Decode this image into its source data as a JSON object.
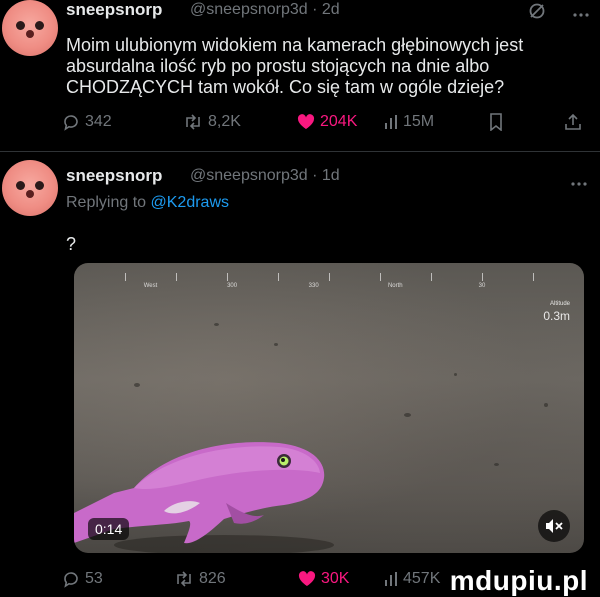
{
  "tweet1": {
    "author": "sneepsnorp",
    "meta": "@sneepsnorp3d · 2d",
    "text_lines": [
      "Moim ulubionym widokiem na kamerach głębinowych jest",
      "absurdalna ilość ryb po prostu stojących na dnie albo",
      "CHODZĄCYCH tam wokół. Co się tam w ogóle dzieje?"
    ],
    "replies": "342",
    "reposts": "8,2K",
    "likes": "204K",
    "views": "15M"
  },
  "tweet2": {
    "author": "sneepsnorp",
    "meta": "@sneepsnorp3d · 1d",
    "replying_label": "Replying to",
    "replying_handle": "@K2draws",
    "text": "?",
    "video": {
      "heading_labels": [
        "West",
        "300",
        "330",
        "North",
        "30"
      ],
      "altitude_label": "Altitude",
      "altitude_value": "0.3m",
      "time": "0:14"
    },
    "replies": "53",
    "reposts": "826",
    "likes": "30K",
    "views": "457K"
  },
  "icons": {
    "reply": "reply-icon",
    "repost": "repost-icon",
    "like": "heart-icon",
    "views": "views-icon",
    "bookmark": "bookmark-icon",
    "share": "share-icon",
    "more": "more-icon",
    "grok": "grok-icon",
    "mute": "volume-muted-icon"
  },
  "colors": {
    "like_active": "#f91880",
    "link": "#1d9bf0",
    "muted_text": "#71767b"
  },
  "watermark": "mdupiu.pl"
}
